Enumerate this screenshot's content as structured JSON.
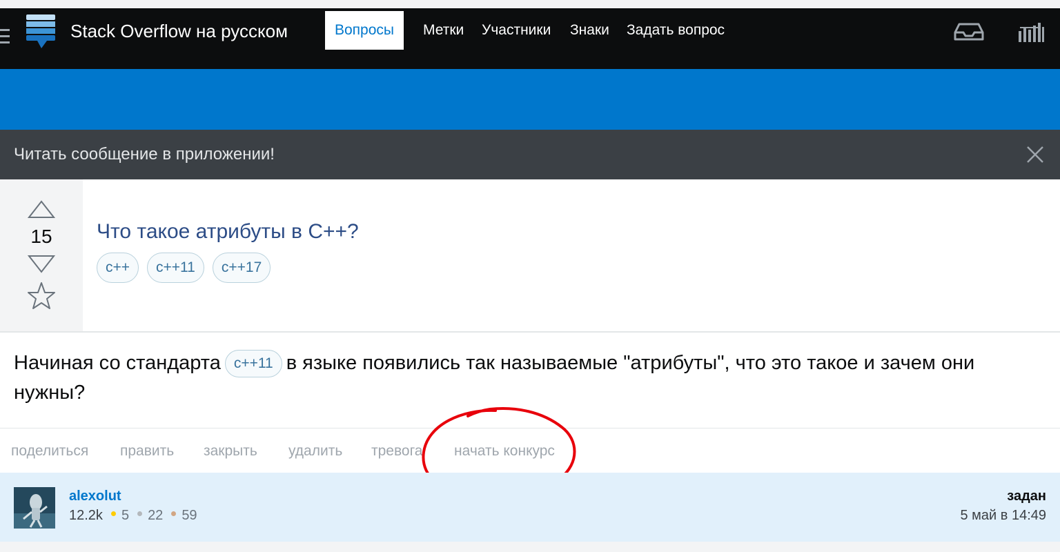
{
  "header": {
    "site_title": "Stack Overflow на русском",
    "icons": [
      "hamburger-menu-icon",
      "stack-overflow-logo",
      "inbox-icon",
      "achievements-icon"
    ]
  },
  "nav": {
    "items": [
      {
        "label": "Вопросы",
        "active": true
      },
      {
        "label": "Метки",
        "active": false
      },
      {
        "label": "Участники",
        "active": false
      },
      {
        "label": "Знаки",
        "active": false
      },
      {
        "label": "Задать вопрос",
        "active": false
      }
    ]
  },
  "banner": {
    "text": "Читать сообщение в приложении!"
  },
  "question": {
    "votes": "15",
    "title": "Что такое атрибуты в C++?",
    "tags": [
      "c++",
      "c++11",
      "c++17"
    ],
    "body_before_tag": "Начиная со стандарта",
    "body_tag": "c++11",
    "body_after_tag": "в языке появились так называемые \"атрибуты\", что это такое и зачем они нужны?"
  },
  "actions": [
    "поделиться",
    "править",
    "закрыть",
    "удалить",
    "тревога",
    "начать конкурс"
  ],
  "author": {
    "username": "alexolut",
    "reputation": "12.2k",
    "badges": {
      "gold": "5",
      "silver": "22",
      "bronze": "59"
    },
    "asked_label": "задан",
    "asked_date": "5 май в 14:49"
  },
  "colors": {
    "topbar": "#0c0d0e",
    "nav": "#0077cc",
    "banner": "#3b4045",
    "title_link": "#2c4c86",
    "annotation": "#e8000b",
    "gold": "#ffcc01",
    "silver": "#b4b8bc",
    "bronze": "#d1a684"
  }
}
